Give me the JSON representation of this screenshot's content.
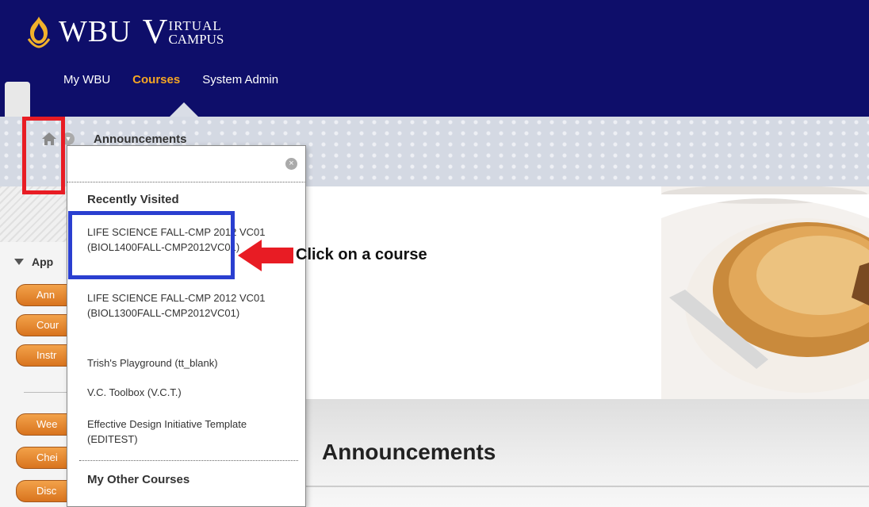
{
  "brand": {
    "wbu": "WBU",
    "v": "V",
    "virtual": "IRTUAL",
    "campus": "CAMPUS"
  },
  "nav": {
    "tabs": [
      "My WBU",
      "Courses",
      "System Admin"
    ],
    "active": "Courses"
  },
  "breadcrumb": {
    "label": "Announcements"
  },
  "menu": {
    "search_value": "",
    "recent_heading": "Recently Visited",
    "recent_items": [
      "LIFE SCIENCE FALL-CMP 2012 VC01 (BIOL1400FALL-CMP2012VC01)",
      "LIFE SCIENCE FALL-CMP 2012 VC01 (BIOL1300FALL-CMP2012VC01)",
      "Trish's Playground (tt_blank)",
      "V.C. Toolbox (V.C.T.)",
      "Effective Design Initiative Template (EDITEST)"
    ],
    "other_heading": "My Other Courses"
  },
  "sidebar": {
    "heading": "App",
    "buttons": [
      "Ann",
      "Cour",
      "Instr",
      "Wee",
      "Chei",
      "Disc"
    ]
  },
  "main": {
    "title": "Announcements"
  },
  "annotation": {
    "callout": "Click on a course"
  },
  "colors": {
    "header_bg": "#0e0e6a",
    "active_tab": "#f5a623",
    "button": "#e58a34",
    "red_box": "#e81c24",
    "blue_box": "#2a3fd0"
  }
}
